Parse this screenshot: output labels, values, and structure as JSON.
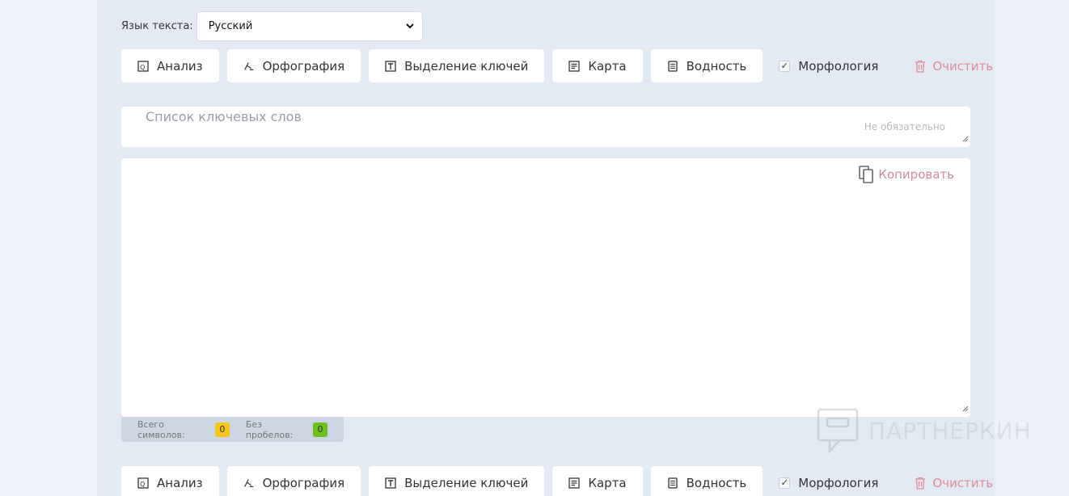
{
  "lang": {
    "label": "Язык текста:",
    "selected": "Русский"
  },
  "toolbar": {
    "analysis": "Анализ",
    "spelling": "Орфография",
    "keys": "Выделение ключей",
    "map": "Карта",
    "water": "Водность",
    "morphology": "Морфология",
    "clear": "Очистить"
  },
  "keywords": {
    "placeholder": "Список ключевых слов",
    "optional": "Не обязательно"
  },
  "editor": {
    "copy": "Копировать"
  },
  "counter": {
    "total_label": "Всего символов:",
    "total_value": "0",
    "nospace_label": "Без пробелов:",
    "nospace_value": "0"
  },
  "watermark": {
    "text": "ПАРТНЕРКИН"
  },
  "colors": {
    "accent": "#e08a9a",
    "badge_yellow": "#f5c518",
    "badge_green": "#6cc11d"
  }
}
